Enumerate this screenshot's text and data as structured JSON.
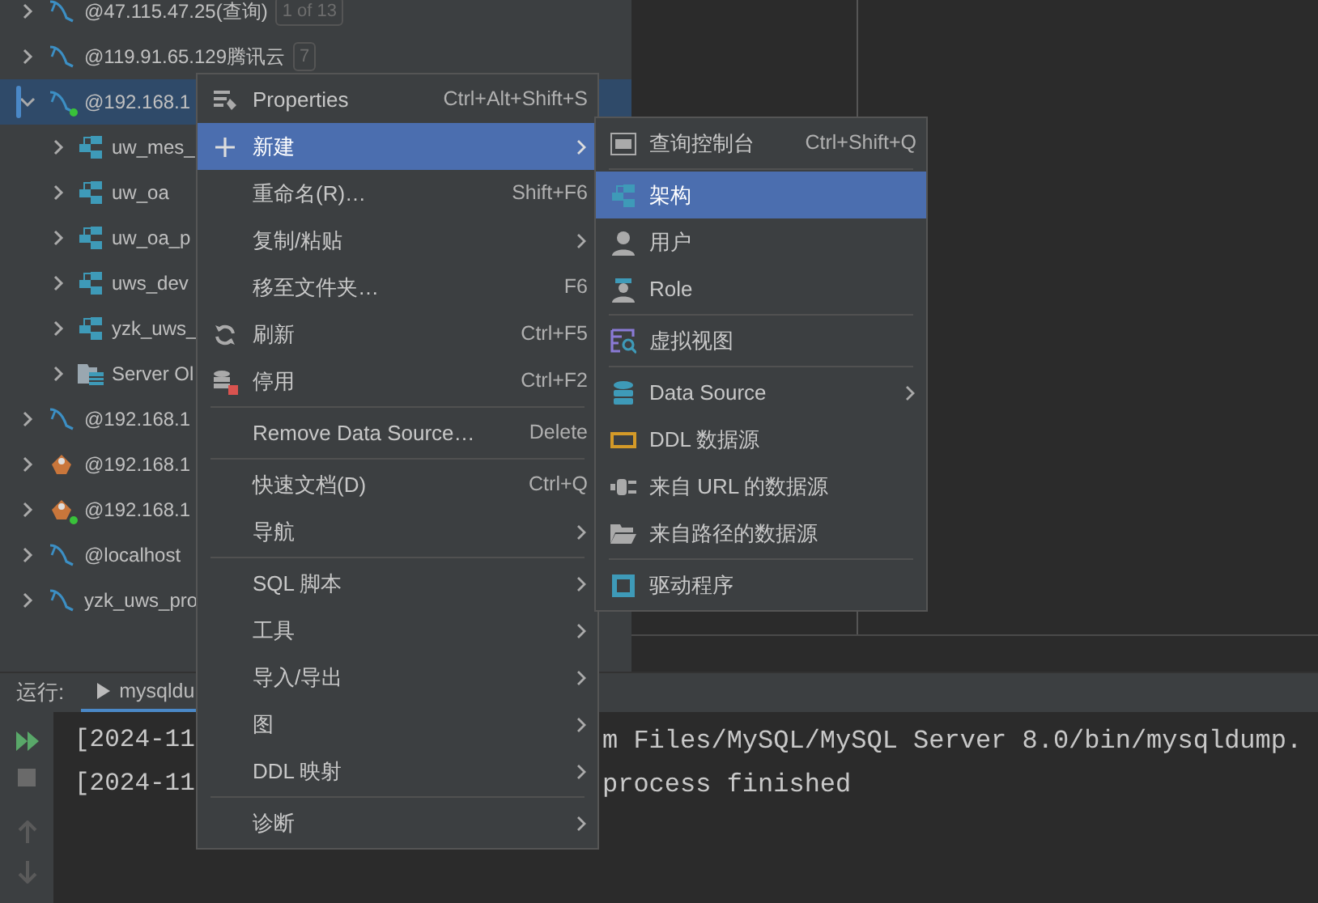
{
  "tree": [
    {
      "label": "@47.115.47.25(查询)",
      "badge": "1 of 13",
      "kind": "mysql",
      "connected": false,
      "expanded": false,
      "selected": false
    },
    {
      "label": "@119.91.65.129腾讯云",
      "badge": "7",
      "kind": "mysql",
      "connected": false,
      "expanded": false,
      "selected": false
    },
    {
      "label": "@192.168.1",
      "kind": "mysql",
      "connected": true,
      "expanded": true,
      "selected": true,
      "children": [
        {
          "label": "uw_mes_",
          "kind": "schema",
          "expanded": false,
          "selected": false
        },
        {
          "label": "uw_oa",
          "kind": "schema",
          "expanded": false,
          "selected": false
        },
        {
          "label": "uw_oa_p",
          "kind": "schema",
          "expanded": false,
          "selected": false
        },
        {
          "label": "uws_dev",
          "kind": "schema",
          "expanded": false,
          "selected": false
        },
        {
          "label": "yzk_uws_",
          "kind": "schema",
          "expanded": false,
          "selected": false
        },
        {
          "label": "Server Ol",
          "kind": "server",
          "expanded": false,
          "selected": false
        }
      ]
    },
    {
      "label": "@192.168.1",
      "kind": "mysql",
      "connected": false,
      "expanded": false,
      "selected": false
    },
    {
      "label": "@192.168.1",
      "kind": "other",
      "connected": false,
      "expanded": false,
      "selected": false
    },
    {
      "label": "@192.168.1",
      "kind": "other",
      "connected": true,
      "expanded": false,
      "selected": false
    },
    {
      "label": "@localhost",
      "kind": "mysql",
      "connected": false,
      "expanded": false,
      "selected": false
    },
    {
      "label": "yzk_uws_pro",
      "kind": "mysql",
      "connected": false,
      "expanded": false,
      "selected": false
    }
  ],
  "context_menu": [
    {
      "kind": "item",
      "label": "Properties",
      "shortcut": "Ctrl+Alt+Shift+S",
      "submenu": false,
      "selected": false
    },
    {
      "kind": "item",
      "label": "新建",
      "submenu": true,
      "selected": true
    },
    {
      "kind": "item",
      "label": "重命名(R)…",
      "shortcut": "Shift+F6",
      "submenu": false,
      "selected": false
    },
    {
      "kind": "item",
      "label": "复制/粘贴",
      "submenu": true,
      "selected": false
    },
    {
      "kind": "item",
      "label": "移至文件夹…",
      "shortcut": "F6",
      "submenu": false,
      "selected": false
    },
    {
      "kind": "item",
      "label": "刷新",
      "shortcut": "Ctrl+F5",
      "submenu": false,
      "selected": false
    },
    {
      "kind": "item",
      "label": "停用",
      "shortcut": "Ctrl+F2",
      "submenu": false,
      "selected": false
    },
    {
      "kind": "separator"
    },
    {
      "kind": "item",
      "label": "Remove Data Source…",
      "shortcut": "Delete",
      "submenu": false,
      "selected": false
    },
    {
      "kind": "separator"
    },
    {
      "kind": "item",
      "label": "快速文档(D)",
      "shortcut": "Ctrl+Q",
      "submenu": false,
      "selected": false
    },
    {
      "kind": "item",
      "label": "导航",
      "submenu": true,
      "selected": false
    },
    {
      "kind": "separator"
    },
    {
      "kind": "item",
      "label": "SQL 脚本",
      "submenu": true,
      "selected": false
    },
    {
      "kind": "item",
      "label": "工具",
      "submenu": true,
      "selected": false
    },
    {
      "kind": "item",
      "label": "导入/导出",
      "submenu": true,
      "selected": false
    },
    {
      "kind": "item",
      "label": "图",
      "submenu": true,
      "selected": false
    },
    {
      "kind": "item",
      "label": "DDL 映射",
      "submenu": true,
      "selected": false
    },
    {
      "kind": "separator"
    },
    {
      "kind": "item",
      "label": "诊断",
      "submenu": true,
      "selected": false
    }
  ],
  "submenu": [
    {
      "kind": "item",
      "label": "查询控制台",
      "shortcut": "Ctrl+Shift+Q",
      "submenu": false,
      "selected": false
    },
    {
      "kind": "separator"
    },
    {
      "kind": "item",
      "label": "架构",
      "submenu": false,
      "selected": true
    },
    {
      "kind": "item",
      "label": "用户",
      "submenu": false,
      "selected": false
    },
    {
      "kind": "item",
      "label": "Role",
      "submenu": false,
      "selected": false
    },
    {
      "kind": "separator"
    },
    {
      "kind": "item",
      "label": "虚拟视图",
      "submenu": false,
      "selected": false
    },
    {
      "kind": "separator"
    },
    {
      "kind": "item",
      "label": "Data Source",
      "submenu": true,
      "selected": false
    },
    {
      "kind": "item",
      "label": "DDL 数据源",
      "submenu": false,
      "selected": false
    },
    {
      "kind": "item",
      "label": "来自 URL 的数据源",
      "submenu": false,
      "selected": false
    },
    {
      "kind": "item",
      "label": "来自路径的数据源",
      "submenu": false,
      "selected": false
    },
    {
      "kind": "separator"
    },
    {
      "kind": "item",
      "label": "驱动程序",
      "submenu": false,
      "selected": false
    }
  ],
  "run_panel": {
    "label": "运行:",
    "tab": "mysqldu",
    "lines": [
      {
        "start": "[2024-11",
        "end": "m Files/MySQL/MySQL Server 8.0/bin/mysqldump."
      },
      {
        "start": "[2024-11",
        "end": "process finished"
      }
    ]
  }
}
